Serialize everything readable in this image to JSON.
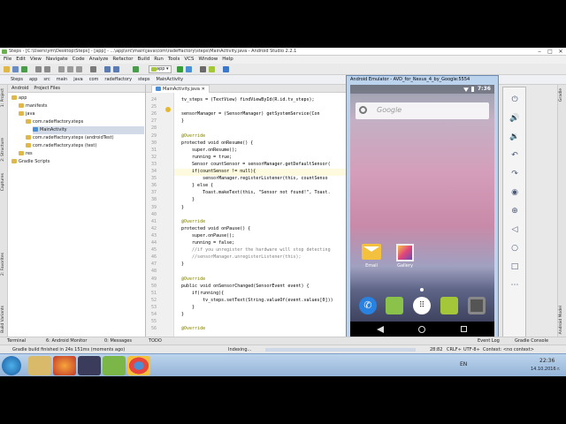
{
  "window": {
    "title": "Steps - [C:\\Users\\ym\\Desktop\\Steps] - [app] - ...\\app\\src\\main\\java\\com\\radeffactory\\steps\\MainActivity.java - Android Studio 2.2.1"
  },
  "menu": [
    "File",
    "Edit",
    "View",
    "Navigate",
    "Code",
    "Analyze",
    "Refactor",
    "Build",
    "Run",
    "Tools",
    "VCS",
    "Window",
    "Help"
  ],
  "toolbar": {
    "run_config": "app"
  },
  "breadcrumb": [
    "Steps",
    "app",
    "src",
    "main",
    "java",
    "com",
    "radeffactory",
    "steps",
    "MainActivity"
  ],
  "project_panel": {
    "tabs": [
      "Android",
      "Project Files"
    ],
    "tree": [
      {
        "label": "app",
        "indent": 0
      },
      {
        "label": "manifests",
        "indent": 1
      },
      {
        "label": "java",
        "indent": 1
      },
      {
        "label": "com.radeffactory.steps",
        "indent": 2
      },
      {
        "label": "MainActivity",
        "indent": 3,
        "selected": true
      },
      {
        "label": "com.radeffactory.steps (androidTest)",
        "indent": 2
      },
      {
        "label": "com.radeffactory.steps (test)",
        "indent": 2
      },
      {
        "label": "res",
        "indent": 1
      },
      {
        "label": "Gradle Scripts",
        "indent": 0
      }
    ]
  },
  "left_tool_tabs": [
    "1: Project",
    "2: Structure",
    "Captures",
    "2: Favorites",
    "Build Variants"
  ],
  "right_tool_tabs": [
    "Gradle",
    "Android Model"
  ],
  "editor": {
    "tab": "MainActivity.java",
    "lines": [
      {
        "n": "24",
        "t": "tv_steps = (TextView) findViewById(R.id.tv_steps);"
      },
      {
        "n": "25",
        "t": ""
      },
      {
        "n": "26",
        "t": "sensorManager = (SensorManager) getSystemService(Con"
      },
      {
        "n": "27",
        "t": "}"
      },
      {
        "n": "28",
        "t": ""
      },
      {
        "n": "29",
        "t": "@Override"
      },
      {
        "n": "30",
        "t": "protected void onResume() {"
      },
      {
        "n": "31",
        "t": "    super.onResume();"
      },
      {
        "n": "32",
        "t": "    running = true;"
      },
      {
        "n": "33",
        "t": "    Sensor countSensor = sensorManager.getDefaultSensor("
      },
      {
        "n": "34",
        "t": "    if(countSensor != null){"
      },
      {
        "n": "35",
        "t": "        sensorManager.registerListener(this, countSenso"
      },
      {
        "n": "36",
        "t": "    } else {"
      },
      {
        "n": "37",
        "t": "        Toast.makeText(this, \"Sensor not found!\", Toast."
      },
      {
        "n": "38",
        "t": "    }"
      },
      {
        "n": "39",
        "t": "}"
      },
      {
        "n": "40",
        "t": ""
      },
      {
        "n": "41",
        "t": "@Override"
      },
      {
        "n": "42",
        "t": "protected void onPause() {"
      },
      {
        "n": "43",
        "t": "    super.onPause();"
      },
      {
        "n": "44",
        "t": "    running = false;"
      },
      {
        "n": "45",
        "t": "    //if you unregister the hardware will stop detecting"
      },
      {
        "n": "46",
        "t": "    //sensorManager.unregisterListener(this);"
      },
      {
        "n": "47",
        "t": "}"
      },
      {
        "n": "48",
        "t": ""
      },
      {
        "n": "49",
        "t": "@Override"
      },
      {
        "n": "50",
        "t": "public void onSensorChanged(SensorEvent event) {"
      },
      {
        "n": "51",
        "t": "    if(running){"
      },
      {
        "n": "52",
        "t": "        tv_steps.setText(String.valueOf(event.values[0]))"
      },
      {
        "n": "53",
        "t": "    }"
      },
      {
        "n": "54",
        "t": "}"
      },
      {
        "n": "55",
        "t": ""
      },
      {
        "n": "56",
        "t": "@Override"
      }
    ]
  },
  "emulator": {
    "title": "Android Emulator - AVD_for_Nexus_4_by_Google:5554",
    "clock": "7:36",
    "search_placeholder": "Google",
    "apps": [
      {
        "label": "Email"
      },
      {
        "label": "Gallery"
      }
    ],
    "dock": [
      "phone",
      "messages",
      "apps",
      "android-store",
      "camera"
    ]
  },
  "bottom_tabs": [
    "Terminal",
    "6: Android Monitor",
    "0: Messages",
    "TODO",
    "Event Log",
    "Gradle Console"
  ],
  "statusline": {
    "message": "Gradle build finished in 24s 151ms (moments ago)",
    "indexing": "Indexing...",
    "position": "28:82",
    "line_sep": "CRLF÷",
    "encoding": "UTF-8÷",
    "context": "Context: <no context>"
  },
  "taskbar": {
    "lang": "EN",
    "time": "22:36",
    "date": "14.10.2016 r."
  },
  "colors": {
    "accent": "#3c5a98",
    "android_green": "#a4c639"
  }
}
